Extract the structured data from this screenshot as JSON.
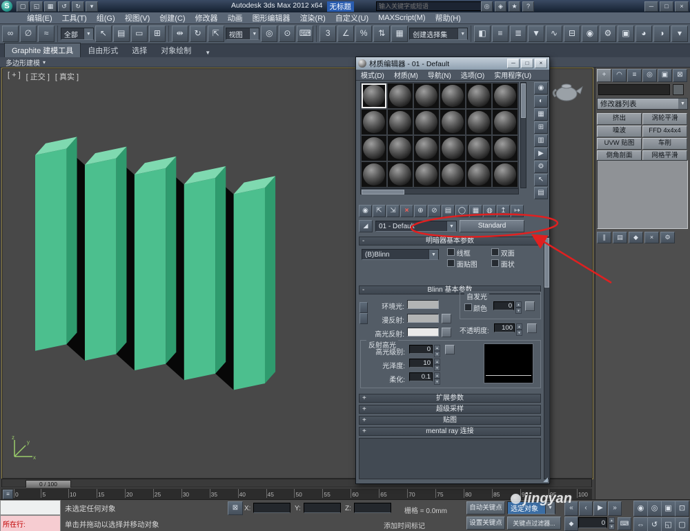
{
  "colors": {
    "annotation_red": "#e02020",
    "accent_blue": "#2a5db0",
    "book_front": "#4cbf8e",
    "book_top": "#7fd9b0",
    "book_side": "#2f9b6e",
    "book_gap": "#070707",
    "axis_green": "#9acd6a"
  },
  "titlebar": {
    "logo": "S",
    "quick_access": [
      {
        "name": "new-scene-icon",
        "glyph": "▢"
      },
      {
        "name": "open-file-icon",
        "glyph": "◱"
      },
      {
        "name": "save-file-icon",
        "glyph": "▦"
      },
      {
        "name": "undo-icon",
        "glyph": "↺"
      },
      {
        "name": "redo-icon",
        "glyph": "↻"
      },
      {
        "name": "quick-access-menu-icon",
        "glyph": "▾"
      }
    ],
    "title_app": "Autodesk 3ds Max 2012 x64",
    "title_doc": "无标题",
    "search_placeholder": "输入关键字或短语",
    "info_icons": [
      {
        "name": "search-icon",
        "glyph": "◎"
      },
      {
        "name": "communication-center-icon",
        "glyph": "◈"
      },
      {
        "name": "favorites-icon",
        "glyph": "★"
      },
      {
        "name": "help-icon",
        "glyph": "?"
      }
    ],
    "window_controls": [
      {
        "name": "minimize-button",
        "glyph": "─"
      },
      {
        "name": "restore-button",
        "glyph": "□"
      },
      {
        "name": "close-button",
        "glyph": "×"
      }
    ]
  },
  "menubar": {
    "items": [
      "编辑(E)",
      "工具(T)",
      "组(G)",
      "视图(V)",
      "创建(C)",
      "修改器",
      "动画",
      "图形编辑器",
      "渲染(R)",
      "自定义(U)",
      "MAXScript(M)",
      "帮助(H)"
    ]
  },
  "toolbar": {
    "link_icons": [
      {
        "name": "select-and-link-icon",
        "glyph": "∞"
      },
      {
        "name": "unlink-selection-icon",
        "glyph": "∅"
      },
      {
        "name": "bind-to-space-warp-icon",
        "glyph": "≈"
      }
    ],
    "filter_value": "全部",
    "select_icons": [
      {
        "name": "select-object-icon",
        "glyph": "↖"
      },
      {
        "name": "select-by-name-icon",
        "glyph": "▤"
      },
      {
        "name": "rectangular-selection-region-icon",
        "glyph": "▭"
      },
      {
        "name": "window-crossing-icon",
        "glyph": "⊞"
      }
    ],
    "transform_icons": [
      {
        "name": "select-and-move-icon",
        "glyph": "⇹"
      },
      {
        "name": "select-and-rotate-icon",
        "glyph": "↻"
      },
      {
        "name": "select-and-scale-icon",
        "glyph": "⇱"
      }
    ],
    "coord_value": "视图",
    "pivot_icons": [
      {
        "name": "use-pivot-point-center-icon",
        "glyph": "◎"
      },
      {
        "name": "select-and-manipulate-icon",
        "glyph": "⊙"
      },
      {
        "name": "keyboard-shortcut-override-icon",
        "glyph": "⌨"
      }
    ],
    "snap_icons": [
      {
        "name": "snap-toggle-3d-icon",
        "glyph": "3"
      },
      {
        "name": "angle-snap-toggle-icon",
        "glyph": "∠"
      },
      {
        "name": "percent-snap-toggle-icon",
        "glyph": "%"
      },
      {
        "name": "spinner-snap-toggle-icon",
        "glyph": "⇅"
      }
    ],
    "named_icons": [
      {
        "name": "edit-named-selection-sets-icon",
        "glyph": "▦"
      }
    ],
    "named_sel_value": "创建选择集",
    "right_icons": [
      {
        "name": "mirror-icon",
        "glyph": "◧"
      },
      {
        "name": "align-icon",
        "glyph": "≡"
      },
      {
        "name": "layer-manager-icon",
        "glyph": "≣"
      },
      {
        "name": "graphite-ribbon-toggle-icon",
        "glyph": "▼"
      },
      {
        "name": "curve-editor-icon",
        "glyph": "∿"
      },
      {
        "name": "schematic-view-icon",
        "glyph": "⊟"
      },
      {
        "name": "material-editor-icon",
        "glyph": "◉"
      },
      {
        "name": "render-setup-icon",
        "glyph": "⚙"
      },
      {
        "name": "rendered-frame-window-icon",
        "glyph": "▣"
      },
      {
        "name": "render-production-icon",
        "glyph": "◕"
      },
      {
        "name": "render-iterative-icon",
        "glyph": "◑"
      },
      {
        "name": "render-preset-icon",
        "glyph": "▾"
      }
    ]
  },
  "ribbon": {
    "main_tab": "Graphite 建模工具",
    "tabs": [
      "自由形式",
      "选择",
      "对象绘制"
    ],
    "caret": "▼",
    "subrow": "多边形建模",
    "subrow_caret": "▾"
  },
  "viewport": {
    "label_general": "[ + ]",
    "label_pov": "[ 正交 ]",
    "label_shading": "[ 真实 ]"
  },
  "timeline": {
    "slider_label": "0 / 100",
    "ticks": [
      "0",
      "5",
      "10",
      "15",
      "20",
      "25",
      "30",
      "35",
      "40",
      "45",
      "50",
      "55",
      "60",
      "65",
      "70",
      "75",
      "80",
      "85",
      "90",
      "95",
      "100"
    ]
  },
  "material_editor": {
    "title": "材质编辑器 - 01 - Default",
    "window_controls": [
      {
        "name": "minimize-button",
        "glyph": "─"
      },
      {
        "name": "restore-button",
        "glyph": "□"
      },
      {
        "name": "close-button",
        "glyph": "×"
      }
    ],
    "menus": [
      "模式(D)",
      "材质(M)",
      "导航(N)",
      "选项(O)",
      "实用程序(U)"
    ],
    "sample_slot_count": 24,
    "side_tools": [
      {
        "name": "sample-type-icon",
        "glyph": "◉"
      },
      {
        "name": "backlight-icon",
        "glyph": "◐"
      },
      {
        "name": "background-icon",
        "glyph": "▦"
      },
      {
        "name": "sample-uv-tiling-icon",
        "glyph": "⊞"
      },
      {
        "name": "video-color-check-icon",
        "glyph": "▥"
      },
      {
        "name": "make-preview-icon",
        "glyph": "▶"
      },
      {
        "name": "material-editor-options-icon",
        "glyph": "⚙"
      },
      {
        "name": "select-by-material-icon",
        "glyph": "↖"
      },
      {
        "name": "material-map-navigator-icon",
        "glyph": "▤"
      }
    ],
    "toolbar_icons": [
      {
        "name": "get-material-icon",
        "glyph": "◉"
      },
      {
        "name": "put-material-to-scene-icon",
        "glyph": "⇱"
      },
      {
        "name": "assign-material-to-selection-icon",
        "glyph": "⇲"
      },
      {
        "name": "reset-map-icon",
        "glyph": "×"
      },
      {
        "name": "make-material-copy-icon",
        "glyph": "⊕"
      },
      {
        "name": "make-unique-icon",
        "glyph": "⊘"
      },
      {
        "name": "put-to-library-icon",
        "glyph": "▤"
      },
      {
        "name": "material-id-channel-icon",
        "glyph": "◯"
      },
      {
        "name": "show-shaded-material-in-viewport-icon",
        "glyph": "▦"
      },
      {
        "name": "show-end-result-icon",
        "glyph": "◍"
      },
      {
        "name": "go-to-parent-icon",
        "glyph": "↥"
      },
      {
        "name": "go-forward-to-sibling-icon",
        "glyph": "↦"
      }
    ],
    "pick_glyph": "◢",
    "material_name": "01 - Default",
    "type_button": "Standard",
    "rollout_shader": {
      "state": "-",
      "title": "明暗器基本参数",
      "shader_value": "(B)Blinn",
      "checkboxes": [
        "线框",
        "双面",
        "面贴图",
        "面状"
      ]
    },
    "rollout_blinn": {
      "state": "-",
      "title": "Blinn 基本参数",
      "ambient_label": "环境光:",
      "diffuse_label": "漫反射:",
      "specular_label": "高光反射:",
      "ambient_color": "#b2b4b4",
      "diffuse_color": "#b2b4b4",
      "specular_color": "#e9e9e9",
      "selfillum_label": "自发光",
      "color_checkbox_label": "颜色",
      "selfillum_value": "0",
      "opacity_label": "不透明度:",
      "opacity_value": "100",
      "highlight_group": "反射高光",
      "specular_level_label": "高光级别:",
      "specular_level_value": "0",
      "glossiness_label": "光泽度:",
      "glossiness_value": "10",
      "soften_label": "柔化:",
      "soften_value": "0.1"
    },
    "rollouts_collapsed": [
      {
        "state": "+",
        "title": "扩展参数"
      },
      {
        "state": "+",
        "title": "超级采样"
      },
      {
        "state": "+",
        "title": "贴图"
      },
      {
        "state": "+",
        "title": "mental ray 连接"
      }
    ]
  },
  "command_panel": {
    "tabs": [
      {
        "name": "create-tab",
        "glyph": "+"
      },
      {
        "name": "modify-tab",
        "glyph": "◠"
      },
      {
        "name": "hierarchy-tab",
        "glyph": "≡"
      },
      {
        "name": "motion-tab",
        "glyph": "◎"
      },
      {
        "name": "display-tab",
        "glyph": "▣"
      },
      {
        "name": "utilities-tab",
        "glyph": "⊠"
      }
    ],
    "modifier_list_label": "修改器列表",
    "modifier_buttons": [
      "挤出",
      "涡轮平滑",
      "噪波",
      "FFD 4x4x4",
      "UVW 贴图",
      "车削",
      "倒角剖面",
      "网格平滑"
    ],
    "stack_icons": [
      {
        "name": "pin-stack-icon",
        "glyph": "∥"
      },
      {
        "name": "show-end-result-icon",
        "glyph": "▤"
      },
      {
        "name": "make-unique-icon",
        "glyph": "◆"
      },
      {
        "name": "remove-modifier-icon",
        "glyph": "×"
      },
      {
        "name": "configure-modifier-sets-icon",
        "glyph": "⚙"
      }
    ]
  },
  "status_bar": {
    "listener_label": "所在行:",
    "prompt_line1": "未选定任何对象",
    "prompt_line2": "单击并拖动以选择并移动对象",
    "x_label": "X:",
    "y_label": "Y:",
    "z_label": "Z:",
    "grid_label": "栅格 = 0.0mm",
    "add_time_tag": "添加时间标记",
    "auto_key_label": "自动关键点",
    "set_key_label": "设置关键点",
    "key_filter_value": "选定对象",
    "key_filters_label": "关键点过滤器...",
    "time_value": "0",
    "transport_icons": [
      {
        "name": "go-to-start-icon",
        "glyph": "«"
      },
      {
        "name": "previous-frame-icon",
        "glyph": "‹"
      },
      {
        "name": "play-icon",
        "glyph": "▶"
      },
      {
        "name": "go-to-end-icon",
        "glyph": "»"
      }
    ],
    "key_mode_glyph": "◆",
    "keyboard_glyph": "⌨",
    "nav_icons": [
      {
        "name": "zoom-icon",
        "glyph": "◉"
      },
      {
        "name": "zoom-all-icon",
        "glyph": "◎"
      },
      {
        "name": "zoom-extents-icon",
        "glyph": "▣"
      },
      {
        "name": "zoom-region-icon",
        "glyph": "⊡"
      },
      {
        "name": "pan-icon",
        "glyph": "⇔"
      },
      {
        "name": "orbit-icon",
        "glyph": "↺"
      },
      {
        "name": "maximize-viewport-toggle-icon",
        "glyph": "◱"
      },
      {
        "name": "viewport-layout-icon",
        "glyph": "▢"
      }
    ]
  },
  "watermark": "jingyan"
}
